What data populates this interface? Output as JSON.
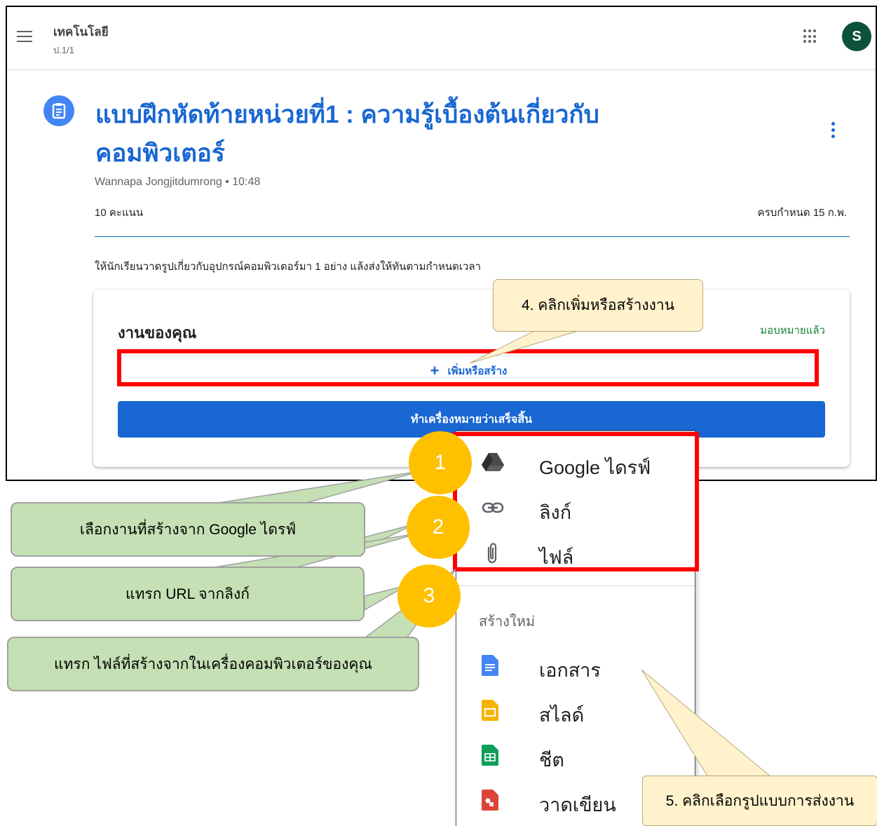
{
  "header": {
    "class_title": "เทคโนโลยี",
    "class_section": "ป.1/1",
    "avatar_letter": "S"
  },
  "assignment": {
    "title": "แบบฝึกหัดท้ายหน่วยที่1 : ความรู้เบื้องต้นเกี่ยวกับคอมพิวเตอร์",
    "author_time": "Wannapa Jongjitdumrong • 10:48",
    "points": "10 คะแนน",
    "due": "ครบกำหนด 15 ก.พ.",
    "instructions": "ให้นักเรียนวาดรูปเกี่ยวกับอุปกรณ์คอมพิวเตอร์มา 1 อย่าง แล้งส่งให้ทันตามกำหนดเวลา"
  },
  "your_work": {
    "title": "งานของคุณ",
    "status": "มอบหมายแล้ว",
    "add_label": "เพิ่มหรือสร้าง",
    "mark_done_label": "ทำเครื่องหมายว่าเสร็จสิ้น"
  },
  "menu": {
    "items": [
      {
        "label": "Google ไดรฟ์",
        "icon": "google-drive-icon"
      },
      {
        "label": "ลิงก์",
        "icon": "link-icon"
      },
      {
        "label": "ไฟล์",
        "icon": "paperclip-icon"
      }
    ],
    "create_section": "สร้างใหม่",
    "create_items": [
      {
        "label": "เอกสาร",
        "icon": "docs-icon",
        "color": "#4285f4"
      },
      {
        "label": "สไลด์",
        "icon": "slides-icon",
        "color": "#f4b400"
      },
      {
        "label": "ชีต",
        "icon": "sheets-icon",
        "color": "#0f9d58"
      },
      {
        "label": "วาดเขียน",
        "icon": "drawings-icon",
        "color": "#db4437"
      }
    ]
  },
  "annotations": {
    "numbers": [
      "1",
      "2",
      "3"
    ],
    "callout_add": "4. คลิกเพิ่มหรือสร้างงาน",
    "callout_format": "5. คลิกเลือกรูปแบบการส่งงาน",
    "callout_drive": "เลือกงานที่สร้างจาก Google ไดรฟ์",
    "callout_url": "แทรก URL จากลิงก์",
    "callout_file": "แทรก ไฟล์ที่สร้างจากในเครื่องคอมพิวเตอร์ของคุณ"
  },
  "colors": {
    "accent": "#1967d2",
    "highlight": "#ff0000",
    "badge": "#ffc000",
    "callout_yellow": "#fff2cc",
    "callout_green": "#c5e0b4"
  }
}
